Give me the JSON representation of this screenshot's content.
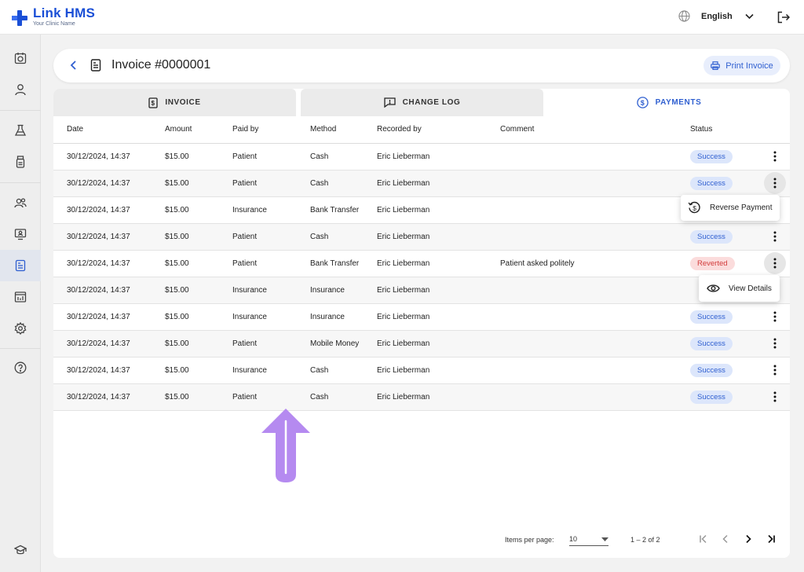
{
  "app": {
    "name": "Link HMS",
    "subtitle": "Your Clinic Name",
    "accent": "#1a4fd6"
  },
  "topbar": {
    "language": "English",
    "globe_icon": "globe-icon",
    "logout_icon": "logout-icon"
  },
  "sidebar": {
    "icons": [
      "appointments-icon",
      "patient-icon",
      "lab-icon",
      "pharmacy-icon",
      "staff-icon",
      "monitor-icon",
      "billing-icon",
      "reports-icon",
      "settings-icon",
      "help-icon",
      "education-icon"
    ],
    "active": "billing-icon"
  },
  "header": {
    "title": "Invoice #0000001",
    "print_label": "Print Invoice"
  },
  "tabs": [
    {
      "label": "INVOICE",
      "icon": "invoice-icon"
    },
    {
      "label": "CHANGE LOG",
      "icon": "change-log-icon"
    },
    {
      "label": "PAYMENTS",
      "icon": "payments-icon",
      "active": true
    }
  ],
  "table": {
    "columns": [
      "Date",
      "Amount",
      "Paid by",
      "Method",
      "Recorded by",
      "Comment",
      "Status"
    ],
    "rows": [
      {
        "date": "30/12/2024, 14:37",
        "amount": "$15.00",
        "paid_by": "Patient",
        "method": "Cash",
        "recorded_by": "Eric Lieberman",
        "comment": "",
        "status": "Success"
      },
      {
        "date": "30/12/2024, 14:37",
        "amount": "$15.00",
        "paid_by": "Patient",
        "method": "Cash",
        "recorded_by": "Eric Lieberman",
        "comment": "",
        "status": "Success"
      },
      {
        "date": "30/12/2024, 14:37",
        "amount": "$15.00",
        "paid_by": "Insurance",
        "method": "Bank Transfer",
        "recorded_by": "Eric Lieberman",
        "comment": "",
        "status": ""
      },
      {
        "date": "30/12/2024, 14:37",
        "amount": "$15.00",
        "paid_by": "Patient",
        "method": "Cash",
        "recorded_by": "Eric Lieberman",
        "comment": "",
        "status": "Success"
      },
      {
        "date": "30/12/2024, 14:37",
        "amount": "$15.00",
        "paid_by": "Patient",
        "method": "Bank Transfer",
        "recorded_by": "Eric Lieberman",
        "comment": "Patient asked politely",
        "status": "Reverted"
      },
      {
        "date": "30/12/2024, 14:37",
        "amount": "$15.00",
        "paid_by": "Insurance",
        "method": "Insurance",
        "recorded_by": "Eric Lieberman",
        "comment": "",
        "status": ""
      },
      {
        "date": "30/12/2024, 14:37",
        "amount": "$15.00",
        "paid_by": "Insurance",
        "method": "Insurance",
        "recorded_by": "Eric Lieberman",
        "comment": "",
        "status": "Success"
      },
      {
        "date": "30/12/2024, 14:37",
        "amount": "$15.00",
        "paid_by": "Patient",
        "method": "Mobile Money",
        "recorded_by": "Eric Lieberman",
        "comment": "",
        "status": "Success"
      },
      {
        "date": "30/12/2024, 14:37",
        "amount": "$15.00",
        "paid_by": "Insurance",
        "method": "Cash",
        "recorded_by": "Eric Lieberman",
        "comment": "",
        "status": "Success"
      },
      {
        "date": "30/12/2024, 14:37",
        "amount": "$15.00",
        "paid_by": "Patient",
        "method": "Cash",
        "recorded_by": "Eric Lieberman",
        "comment": "",
        "status": "Success"
      }
    ],
    "status_colors": {
      "success": "#2f5fd0",
      "reverted": "#d23b3b"
    }
  },
  "menus": {
    "reverse_payment": "Reverse Payment",
    "view_details": "View Details"
  },
  "pagination": {
    "items_per_page_label": "Items per page:",
    "items_per_page": "10",
    "range": "1 – 2 of 2"
  },
  "annotation": {
    "arrow_color": "#b58af0"
  }
}
